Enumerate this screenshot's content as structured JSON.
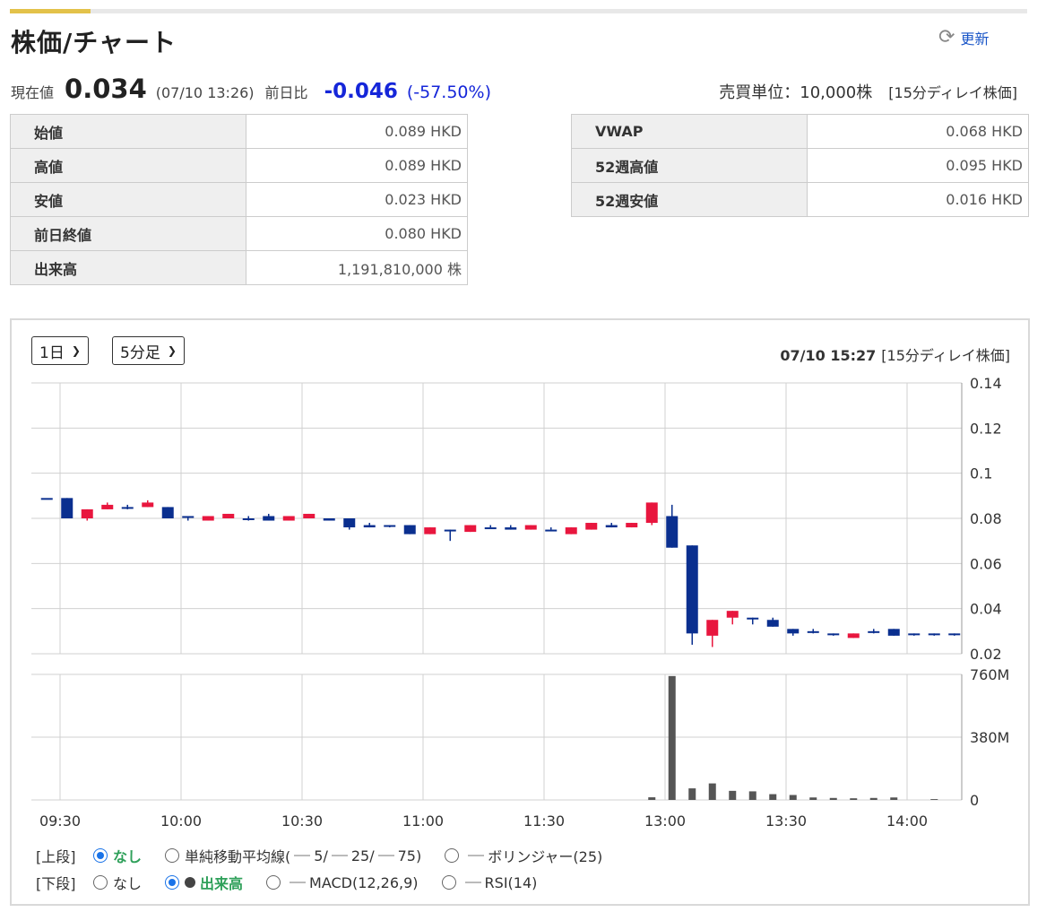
{
  "header": {
    "title": "株価/チャート",
    "refresh_label": "更新",
    "refresh_icon": "refresh-icon"
  },
  "quote": {
    "current_label": "現在値",
    "current_value": "0.034",
    "timestamp": "(07/10 13:26)",
    "change_label": "前日比",
    "change_value": "-0.046",
    "change_percent": "(-57.50%)",
    "trade_unit": "売買単位：10,000株",
    "delay_note": "[15分ディレイ株価]"
  },
  "stats_left": [
    {
      "label": "始値",
      "value": "0.089 HKD"
    },
    {
      "label": "高値",
      "value": "0.089 HKD"
    },
    {
      "label": "安値",
      "value": "0.023 HKD"
    },
    {
      "label": "前日終値",
      "value": "0.080 HKD"
    },
    {
      "label": "出来高",
      "value": "1,191,810,000 株"
    }
  ],
  "stats_right": [
    {
      "label": "VWAP",
      "value": "0.068 HKD"
    },
    {
      "label": "52週高値",
      "value": "0.095 HKD"
    },
    {
      "label": "52週安値",
      "value": "0.016 HKD"
    }
  ],
  "controls": {
    "period": "1日",
    "interval": "5分足",
    "chart_time": "07/10 15:27",
    "chart_delay": "[15分ディレイ株価]"
  },
  "options": {
    "upper_label": "[上段]",
    "upper": [
      {
        "label": "なし",
        "selected": true
      },
      {
        "label": "単純移動平均線(",
        "ma": [
          "5/",
          "25/",
          "75)"
        ],
        "selected": false
      },
      {
        "label": "ボリンジャー(25)",
        "selected": false
      }
    ],
    "lower_label": "[下段]",
    "lower": [
      {
        "label": "なし",
        "selected": false
      },
      {
        "label": "出来高",
        "selected": true
      },
      {
        "label": "MACD(12,26,9)",
        "selected": false
      },
      {
        "label": "RSI(14)",
        "selected": false
      }
    ]
  },
  "colors": {
    "up": "#e8163e",
    "down": "#0a2f8f",
    "volume": "#555555",
    "grid": "#d0d0d0"
  },
  "chart_data": {
    "type": "candlestick",
    "x_ticks": [
      "09:30",
      "10:00",
      "10:30",
      "11:00",
      "11:30",
      "13:00",
      "13:30",
      "14:00"
    ],
    "y_price_ticks": [
      "0.14",
      "0.12",
      "0.1",
      "0.08",
      "0.06",
      "0.04",
      "0.02"
    ],
    "y_price_range": [
      0.02,
      0.14
    ],
    "y_volume_ticks": [
      "760M",
      "380M",
      "0"
    ],
    "y_volume_range": [
      0,
      760
    ],
    "candles": [
      {
        "t": "09:30",
        "o": 0.089,
        "h": 0.089,
        "l": 0.089,
        "c": 0.089,
        "v": 0
      },
      {
        "t": "09:35",
        "o": 0.089,
        "h": 0.089,
        "l": 0.08,
        "c": 0.08,
        "v": 0
      },
      {
        "t": "09:40",
        "o": 0.08,
        "h": 0.084,
        "l": 0.079,
        "c": 0.084,
        "v": 0
      },
      {
        "t": "09:45",
        "o": 0.084,
        "h": 0.087,
        "l": 0.084,
        "c": 0.086,
        "v": 0
      },
      {
        "t": "09:50",
        "o": 0.085,
        "h": 0.086,
        "l": 0.084,
        "c": 0.085,
        "v": 0
      },
      {
        "t": "09:55",
        "o": 0.085,
        "h": 0.088,
        "l": 0.085,
        "c": 0.087,
        "v": 0
      },
      {
        "t": "10:00",
        "o": 0.085,
        "h": 0.085,
        "l": 0.08,
        "c": 0.08,
        "v": 0
      },
      {
        "t": "10:05",
        "o": 0.081,
        "h": 0.081,
        "l": 0.079,
        "c": 0.081,
        "v": 0
      },
      {
        "t": "10:10",
        "o": 0.079,
        "h": 0.081,
        "l": 0.079,
        "c": 0.081,
        "v": 0
      },
      {
        "t": "10:15",
        "o": 0.08,
        "h": 0.082,
        "l": 0.08,
        "c": 0.082,
        "v": 0
      },
      {
        "t": "10:20",
        "o": 0.08,
        "h": 0.081,
        "l": 0.079,
        "c": 0.08,
        "v": 0
      },
      {
        "t": "10:25",
        "o": 0.081,
        "h": 0.082,
        "l": 0.079,
        "c": 0.079,
        "v": 0
      },
      {
        "t": "10:30",
        "o": 0.079,
        "h": 0.081,
        "l": 0.079,
        "c": 0.081,
        "v": 0
      },
      {
        "t": "10:35",
        "o": 0.08,
        "h": 0.082,
        "l": 0.08,
        "c": 0.082,
        "v": 0
      },
      {
        "t": "10:40",
        "o": 0.08,
        "h": 0.08,
        "l": 0.079,
        "c": 0.079,
        "v": 0
      },
      {
        "t": "10:45",
        "o": 0.08,
        "h": 0.08,
        "l": 0.075,
        "c": 0.076,
        "v": 0
      },
      {
        "t": "10:50",
        "o": 0.077,
        "h": 0.078,
        "l": 0.076,
        "c": 0.076,
        "v": 0
      },
      {
        "t": "10:55",
        "o": 0.077,
        "h": 0.077,
        "l": 0.076,
        "c": 0.077,
        "v": 0
      },
      {
        "t": "11:00",
        "o": 0.077,
        "h": 0.077,
        "l": 0.073,
        "c": 0.073,
        "v": 0
      },
      {
        "t": "11:05",
        "o": 0.073,
        "h": 0.076,
        "l": 0.073,
        "c": 0.076,
        "v": 0
      },
      {
        "t": "11:10",
        "o": 0.075,
        "h": 0.075,
        "l": 0.07,
        "c": 0.075,
        "v": 0
      },
      {
        "t": "11:15",
        "o": 0.074,
        "h": 0.077,
        "l": 0.074,
        "c": 0.077,
        "v": 0
      },
      {
        "t": "11:20",
        "o": 0.076,
        "h": 0.077,
        "l": 0.076,
        "c": 0.076,
        "v": 0
      },
      {
        "t": "11:25",
        "o": 0.076,
        "h": 0.077,
        "l": 0.075,
        "c": 0.075,
        "v": 0
      },
      {
        "t": "11:30",
        "o": 0.075,
        "h": 0.077,
        "l": 0.075,
        "c": 0.077,
        "v": 0
      },
      {
        "t": "12:55",
        "o": 0.075,
        "h": 0.076,
        "l": 0.075,
        "c": 0.075,
        "v": 0
      },
      {
        "t": "13:00",
        "o": 0.073,
        "h": 0.076,
        "l": 0.073,
        "c": 0.076,
        "v": 0
      },
      {
        "t": "13:05",
        "o": 0.075,
        "h": 0.078,
        "l": 0.075,
        "c": 0.078,
        "v": 0
      },
      {
        "t": "13:10",
        "o": 0.077,
        "h": 0.078,
        "l": 0.076,
        "c": 0.076,
        "v": 0
      },
      {
        "t": "13:15",
        "o": 0.076,
        "h": 0.078,
        "l": 0.076,
        "c": 0.078,
        "v": 0
      },
      {
        "t": "12:55b",
        "o": 0.078,
        "h": 0.087,
        "l": 0.077,
        "c": 0.087,
        "v": 16
      },
      {
        "t": "13:00b",
        "o": 0.081,
        "h": 0.086,
        "l": 0.067,
        "c": 0.067,
        "v": 750
      },
      {
        "t": "13:05b",
        "o": 0.068,
        "h": 0.068,
        "l": 0.024,
        "c": 0.029,
        "v": 70
      },
      {
        "t": "13:10b",
        "o": 0.028,
        "h": 0.035,
        "l": 0.023,
        "c": 0.035,
        "v": 100
      },
      {
        "t": "13:15b",
        "o": 0.036,
        "h": 0.039,
        "l": 0.033,
        "c": 0.039,
        "v": 55
      },
      {
        "t": "13:20",
        "o": 0.036,
        "h": 0.036,
        "l": 0.033,
        "c": 0.036,
        "v": 52
      },
      {
        "t": "13:25",
        "o": 0.035,
        "h": 0.036,
        "l": 0.032,
        "c": 0.032,
        "v": 35
      },
      {
        "t": "13:30",
        "o": 0.031,
        "h": 0.031,
        "l": 0.028,
        "c": 0.029,
        "v": 30
      },
      {
        "t": "13:35",
        "o": 0.03,
        "h": 0.031,
        "l": 0.029,
        "c": 0.03,
        "v": 15
      },
      {
        "t": "13:40",
        "o": 0.029,
        "h": 0.029,
        "l": 0.028,
        "c": 0.029,
        "v": 12
      },
      {
        "t": "13:45",
        "o": 0.027,
        "h": 0.029,
        "l": 0.027,
        "c": 0.029,
        "v": 10
      },
      {
        "t": "13:50",
        "o": 0.03,
        "h": 0.031,
        "l": 0.029,
        "c": 0.03,
        "v": 12
      },
      {
        "t": "13:55",
        "o": 0.031,
        "h": 0.031,
        "l": 0.028,
        "c": 0.028,
        "v": 15
      },
      {
        "t": "14:00",
        "o": 0.029,
        "h": 0.029,
        "l": 0.028,
        "c": 0.029,
        "v": 0
      },
      {
        "t": "14:05",
        "o": 0.029,
        "h": 0.029,
        "l": 0.028,
        "c": 0.029,
        "v": 5
      },
      {
        "t": "14:10",
        "o": 0.029,
        "h": 0.029,
        "l": 0.028,
        "c": 0.029,
        "v": 0
      }
    ]
  }
}
